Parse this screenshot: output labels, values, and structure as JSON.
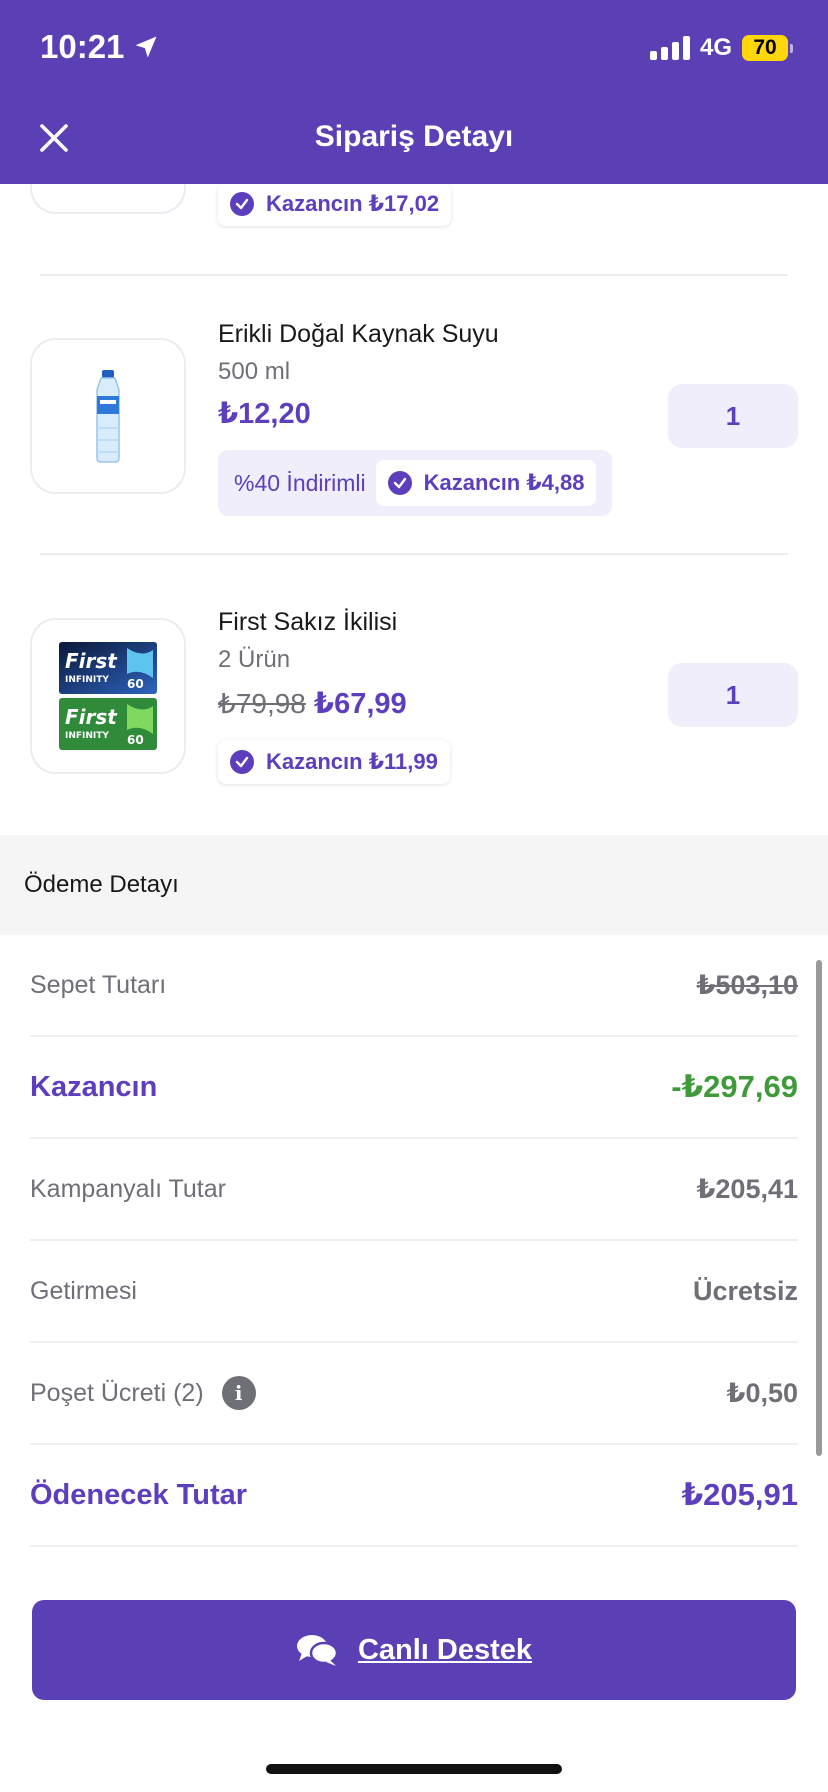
{
  "status_bar": {
    "time": "10:21",
    "network": "4G",
    "battery": "70"
  },
  "header": {
    "title": "Sipariş Detayı"
  },
  "products": [
    {
      "savings": "Kazancın ₺17,02"
    },
    {
      "name": "Erikli Doğal Kaynak Suyu",
      "subtitle": "500 ml",
      "price": "₺12,20",
      "quantity": "1",
      "discount_label": "%40 İndirimli",
      "savings": "Kazancın ₺4,88"
    },
    {
      "name": "First Sakız İkilisi",
      "subtitle": "2 Ürün",
      "old_price": "₺79,98",
      "price": "₺67,99",
      "quantity": "1",
      "savings": "Kazancın ₺11,99"
    }
  ],
  "payment": {
    "title": "Ödeme Detayı",
    "rows": [
      {
        "label": "Sepet Tutarı",
        "value": "₺503,10"
      },
      {
        "label": "Kazancın",
        "value": "-₺297,69"
      },
      {
        "label": "Kampanyalı Tutar",
        "value": "₺205,41"
      },
      {
        "label": "Getirmesi",
        "value": "Ücretsiz"
      },
      {
        "label": "Poşet Ücreti (2)",
        "value": "₺0,50"
      },
      {
        "label": "Ödenecek Tutar",
        "value": "₺205,91"
      }
    ]
  },
  "support_button": {
    "label": "Canlı Destek"
  },
  "colors": {
    "brand": "#5a3fb5",
    "accent": "#5d3ebc",
    "positive": "#3f9a3a",
    "battery": "#ffd60a"
  }
}
